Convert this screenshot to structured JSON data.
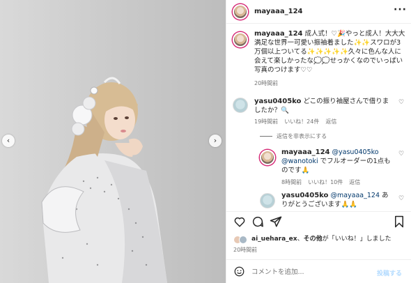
{
  "post": {
    "username": "mayaaa_124",
    "more_icon": "more-dots-icon"
  },
  "caption": {
    "username": "mayaaa_124",
    "text": "成人式！♡🎉やっと成人！大大大満足な世界一可愛い振袖着ました✨✨スワロが3万個以上ついてる✨✨✨✨✨久々に色んな人に会えて楽しかったな💭💭せっかくなのでいっぱい写真のつけます♡♡",
    "time": "20時間前"
  },
  "comments": [
    {
      "username": "yasu0405ko",
      "text": "どこの振り袖屋さんで借りましたか？🔍",
      "time": "19時間前",
      "likes": "いいね！24件",
      "reply": "返信"
    }
  ],
  "replies_toggle": "返信を非表示にする",
  "replies": [
    {
      "username": "mayaaa_124",
      "mention1": "@yasu0405ko",
      "mention2": "@wanotoki",
      "text": "でフルオーダーの1点ものです🙏",
      "time": "8時間前",
      "likes": "いいね！10件",
      "reply": "返信"
    },
    {
      "username": "yasu0405ko",
      "mention": "@mayaaa_124",
      "text": "ありがとうございます🙏🙏"
    }
  ],
  "actions": {
    "like_icon": "heart-icon",
    "comment_icon": "comment-icon",
    "share_icon": "share-icon",
    "save_icon": "bookmark-icon"
  },
  "liked_by": {
    "user": "ai_uehara_ex",
    "text1": "、",
    "bold": "その他",
    "text2": "が「いいね！」しました",
    "time": "20時間前"
  },
  "comment_box": {
    "placeholder": "コメントを追加...",
    "post_label": "投稿する"
  },
  "colors": {
    "link": "#00376b",
    "post_button_disabled": "#b3dbff",
    "ring": "#d62976"
  }
}
